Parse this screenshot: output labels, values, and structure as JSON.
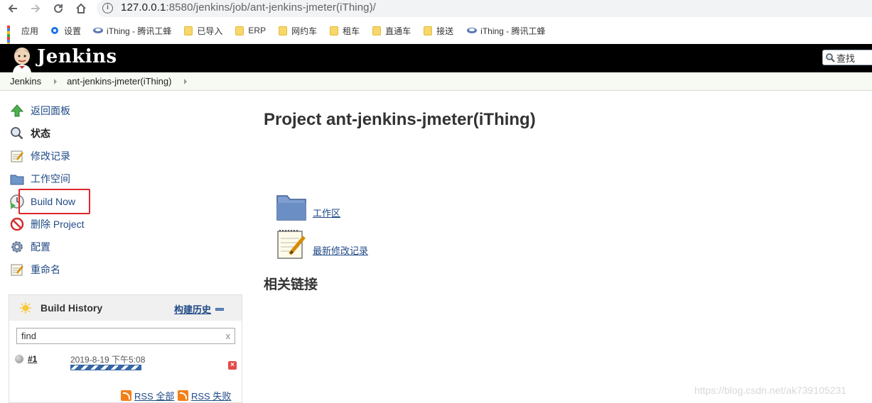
{
  "browser": {
    "url_host": "127.0.0.1",
    "url_rest": ":8580/jenkins/job/ant-jenkins-jmeter(iThing)/",
    "bookmarks": [
      "应用",
      "设置",
      "iThing - 腾讯工蜂",
      "已导入",
      "ERP",
      "网约车",
      "租车",
      "直通车",
      "接送",
      "iThing - 腾讯工蜂"
    ]
  },
  "header": {
    "title": "Jenkins",
    "search_placeholder": "查找"
  },
  "breadcrumb": [
    "Jenkins",
    "ant-jenkins-jmeter(iThing)"
  ],
  "sidebar": {
    "tasks": [
      {
        "label": "返回面板",
        "icon": "up-arrow-icon"
      },
      {
        "label": "状态",
        "icon": "magnifier-icon"
      },
      {
        "label": "修改记录",
        "icon": "notepad-icon"
      },
      {
        "label": "工作空间",
        "icon": "folder-icon"
      },
      {
        "label": "Build Now",
        "icon": "clock-play-icon"
      },
      {
        "label": "删除 Project",
        "icon": "no-entry-icon"
      },
      {
        "label": "配置",
        "icon": "gear-icon"
      },
      {
        "label": "重命名",
        "icon": "notepad-icon"
      }
    ]
  },
  "build_history": {
    "title": "Build History",
    "trend_label": "构建历史",
    "find_value": "find",
    "clear": "x",
    "builds": [
      {
        "number": "#1",
        "date": "2019-8-19 下午5:08",
        "progress": "in-progress"
      }
    ],
    "rss_all": "RSS 全部",
    "rss_failed": "RSS 失败"
  },
  "main": {
    "title": "Project ant-jenkins-jmeter(iThing)",
    "links": [
      "工作区",
      "最新修改记录"
    ],
    "related_heading": "相关链接"
  },
  "watermark": "https://blog.csdn.net/ak739105231"
}
